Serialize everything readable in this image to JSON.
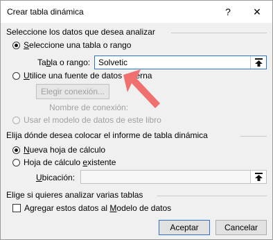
{
  "window": {
    "title": "Crear tabla dinámica",
    "help": "?",
    "close": "✕"
  },
  "section1": {
    "heading": "Seleccione los datos que desea analizar",
    "opt_table": {
      "pre": "",
      "u": "S",
      "post": "eleccione una tabla o rango",
      "checked": true
    },
    "range_label": {
      "pre": "Ta",
      "u": "b",
      "post": "la o rango:"
    },
    "range_value": "Solvetic",
    "opt_external": {
      "pre": "",
      "u": "U",
      "post": "tilice una fuente de datos externa",
      "checked": false
    },
    "choose_connection": "Elegir conexión...",
    "connection_name": "Nombre de conexión:",
    "opt_model": {
      "label": "Usar el modelo de datos de este libro",
      "checked": false
    }
  },
  "section2": {
    "heading": "Elija dónde desea colocar el informe de tabla dinámica",
    "opt_new": {
      "pre": "",
      "u": "N",
      "post": "ueva hoja de cálculo",
      "checked": true
    },
    "opt_existing": {
      "pre": "Hoja de cálculo ",
      "u": "e",
      "post": "xistente",
      "checked": false
    },
    "location_label": {
      "pre": "",
      "u": "U",
      "post": "bicación:"
    },
    "location_value": ""
  },
  "section3": {
    "heading": "Elige si quieres analizar varias tablas",
    "add_model": {
      "pre": "Agregar estos datos al ",
      "u": "M",
      "post": "odelo de datos",
      "checked": false
    }
  },
  "buttons": {
    "ok": "Aceptar",
    "cancel": "Cancelar"
  },
  "icons": {
    "collapse": "collapse-arrow-icon",
    "pointer": "red-arrow-annotation"
  },
  "colors": {
    "accent": "#2f6fd1",
    "annotation": "#f07070"
  }
}
